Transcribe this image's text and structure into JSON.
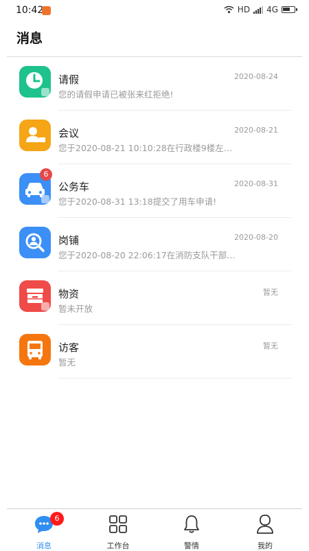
{
  "status_bar": {
    "time": "10:42",
    "network": "HD",
    "cellular": "4G",
    "battery_level": 0.65
  },
  "page": {
    "title": "消息"
  },
  "colors": {
    "leave": "#1dc28c",
    "meeting": "#f5a516",
    "vehicle": "#3b8ff6",
    "post": "#3b8ff6",
    "materials": "#ef4b48",
    "visitor": "#f5760e",
    "tab_active": "#2f8ef0",
    "badge": "#e54848"
  },
  "messages": [
    {
      "title": "请假",
      "date": "2020-08-24",
      "desc": "您的请假申请已被张来红拒绝!",
      "icon": "clock-icon"
    },
    {
      "title": "会议",
      "date": "2020-08-21",
      "desc": "您于2020-08-21 10:10:28在行政楼9楼左…",
      "icon": "meeting-person-icon"
    },
    {
      "title": "公务车",
      "date": "2020-08-31",
      "desc": "您于2020-08-31 13:18提交了用车申请!",
      "icon": "car-icon",
      "badge": "6"
    },
    {
      "title": "岗铺",
      "date": "2020-08-20",
      "desc": "您于2020-08-20 22:06:17在消防支队干部…",
      "icon": "magnifier-person-icon"
    },
    {
      "title": "物资",
      "date": "暂无",
      "desc": "暂未开放",
      "icon": "storage-box-icon"
    },
    {
      "title": "访客",
      "date": "暂无",
      "desc": "暂无",
      "icon": "bus-icon"
    }
  ],
  "tabbar": {
    "tabs": [
      {
        "label": "消息",
        "icon": "chat-bubble-icon",
        "badge": "6",
        "active": true
      },
      {
        "label": "工作台",
        "icon": "grid-icon"
      },
      {
        "label": "警情",
        "icon": "bell-icon"
      },
      {
        "label": "我的",
        "icon": "person-icon"
      }
    ]
  }
}
